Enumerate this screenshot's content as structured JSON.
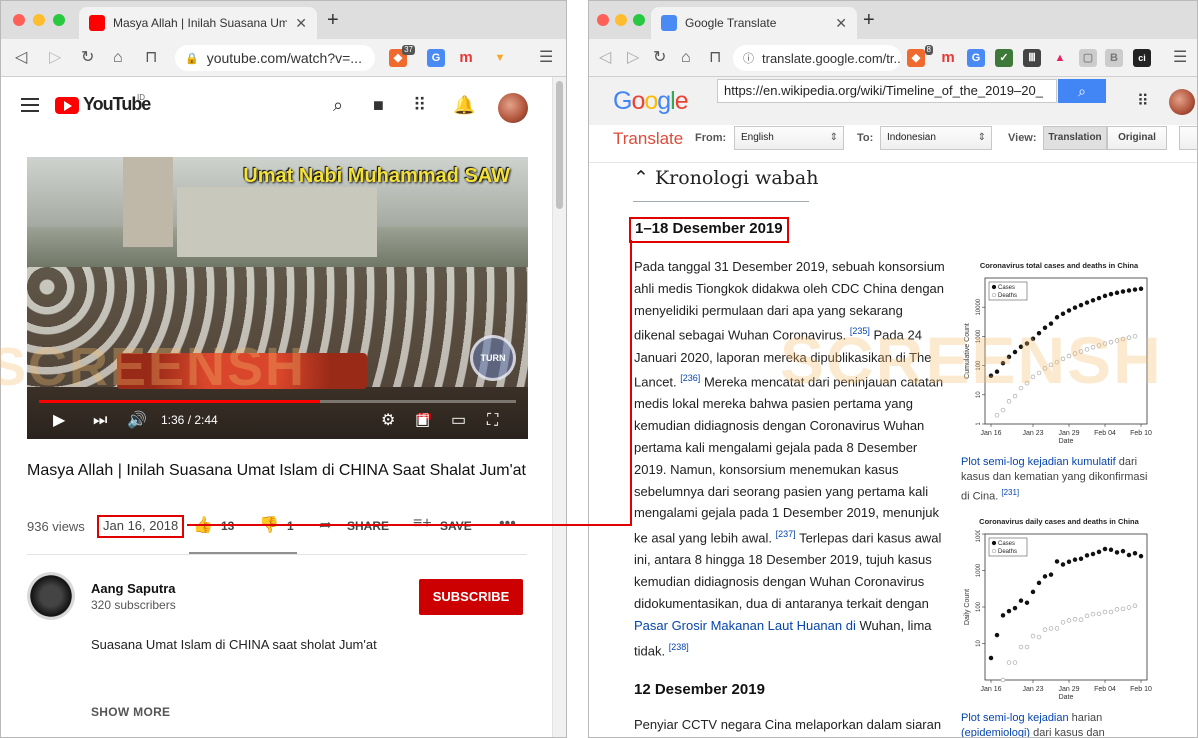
{
  "left_window": {
    "tab_title": "Masya Allah | Inilah Suasana Umat",
    "address": "youtube.com/watch?v=...",
    "ext_badge": "37",
    "header": {
      "logo_text": "YouTube",
      "country": "ID"
    },
    "video": {
      "overlay_caption": "Umat Nabi Muhammad SAW",
      "time": "1:36 / 2:44",
      "progress": 0.59,
      "hd_label": "HD"
    },
    "title": "Masya Allah | Inilah Suasana Umat Islam di CHINA Saat Shalat Jum'at",
    "views": "936 views",
    "date": "Jan 16, 2018",
    "likes": "13",
    "dislikes": "1",
    "share_label": "SHARE",
    "save_label": "SAVE",
    "channel": {
      "name": "Aang Saputra",
      "subscribers": "320 subscribers"
    },
    "subscribe_label": "SUBSCRIBE",
    "description": "Suasana Umat Islam di CHINA saat sholat Jum'at",
    "show_more": "SHOW MORE"
  },
  "right_window": {
    "tab_title": "Google Translate",
    "address": "translate.google.com/tr...",
    "ext_badge": "8",
    "google_logo": "Google",
    "url_value": "https://en.wikipedia.org/wiki/Timeline_of_the_2019–20_",
    "translate_label": "Translate",
    "from_label": "From:",
    "from_value": "English",
    "to_label": "To:",
    "to_value": "Indonesian",
    "view_label": "View:",
    "view_translation": "Translation",
    "view_original": "Original",
    "section_heading": "Kronologi wabah",
    "subheading1": "1–18 Desember 2019",
    "p1_a": "Pada tanggal 31 Desember 2019, sebuah konsorsium ahli medis Tiongkok didakwa oleh CDC China dengan menyelidiki permulaan dari apa yang sekarang dikenal sebagai Wuhan Coronavirus.",
    "ref_235": "[235]",
    "p1_b": " Pada 24 Januari 2020, laporan mereka dipublikasikan di The Lancet.",
    "ref_236": "[236]",
    "p1_c": " Mereka mencatat dari peninjauan catatan medis lokal mereka bahwa pasien pertama yang kemudian didiagnosis dengan Coronavirus Wuhan pertama kali mengalami gejala pada 8 Desember 2019. Namun, konsorsium menemukan kasus sebelumnya dari seorang pasien yang pertama kali mengalami gejala pada 1 Desember 2019, menunjuk ke asal yang lebih awal.",
    "ref_237": "[237]",
    "p1_d": " Terlepas dari kasus awal ini, antara 8 hingga 18 Desember 2019, tujuh kasus kemudian didiagnosis dengan Wuhan Coronavirus didokumentasikan, dua di antaranya terkait dengan ",
    "p1_link": "Pasar Grosir Makanan Laut Huanan di",
    "p1_e": " Wuhan, lima tidak.",
    "ref_238": "[238]",
    "subheading2": "12 Desember 2019",
    "p2": "Penyiar CCTV negara Cina melaporkan dalam siaran",
    "fig1": {
      "cap_link": "Plot semi-log kejadian kumulatif",
      "cap_text": " dari kasus dan kematian yang dikonfirmasi di Cina.",
      "ref": "[231]"
    },
    "fig2": {
      "cap_link": "Plot semi-log kejadian",
      "cap_text1": " harian ",
      "cap_link2": "(epidemiologi)",
      "cap_text2": " dari kasus dan"
    }
  },
  "watermark": "SCREENSH",
  "chart_data": [
    {
      "type": "scatter",
      "title": "Coronavirus total cases and deaths in China",
      "xlabel": "Date",
      "ylabel": "Cumulative Count",
      "yscale": "log",
      "ylim": [
        1,
        100000
      ],
      "x_ticks": [
        "Jan 16",
        "Jan 23",
        "Jan 29",
        "Feb 04",
        "Feb 10"
      ],
      "y_ticks": [
        "1",
        "10",
        "100",
        "1000",
        "10000"
      ],
      "legend": "top-left",
      "series": [
        {
          "name": "Cases",
          "marker": "filled",
          "start_day": 0,
          "values": [
            45,
            62,
            121,
            198,
            291,
            440,
            571,
            830,
            1287,
            1975,
            2744,
            4515,
            5974,
            7711,
            9692,
            11791,
            14380,
            17205,
            20438,
            24324,
            28018,
            31161,
            34546,
            37198,
            40171,
            42638
          ]
        },
        {
          "name": "Deaths",
          "marker": "open",
          "start_day": 1,
          "values": [
            2,
            3,
            6,
            9,
            17,
            25,
            41,
            56,
            80,
            106,
            132,
            170,
            213,
            259,
            304,
            361,
            425,
            490,
            563,
            636,
            722,
            811,
            908,
            1016
          ]
        }
      ]
    },
    {
      "type": "scatter",
      "title": "Coronavirus daily cases and deaths in China",
      "xlabel": "Date",
      "ylabel": "Daily Count",
      "yscale": "log",
      "ylim": [
        1,
        10000
      ],
      "x_ticks": [
        "Jan 16",
        "Jan 23",
        "Jan 29",
        "Feb 04",
        "Feb 10"
      ],
      "y_ticks": [
        "10",
        "100",
        "1000",
        "10000"
      ],
      "legend": "top-left",
      "series": [
        {
          "name": "Cases",
          "marker": "filled",
          "start_day": 0,
          "values": [
            4,
            17,
            59,
            77,
            93,
            149,
            131,
            259,
            457,
            688,
            769,
            1771,
            1459,
            1737,
            1981,
            2099,
            2589,
            2825,
            3233,
            3886,
            3694,
            3143,
            3385,
            2652,
            2973,
            2467
          ]
        },
        {
          "name": "Deaths",
          "marker": "open",
          "start_day": 2,
          "values": [
            1,
            3,
            3,
            8,
            8,
            16,
            15,
            24,
            26,
            26,
            38,
            43,
            46,
            45,
            57,
            64,
            65,
            73,
            73,
            86,
            89,
            97,
            108
          ]
        }
      ]
    }
  ]
}
